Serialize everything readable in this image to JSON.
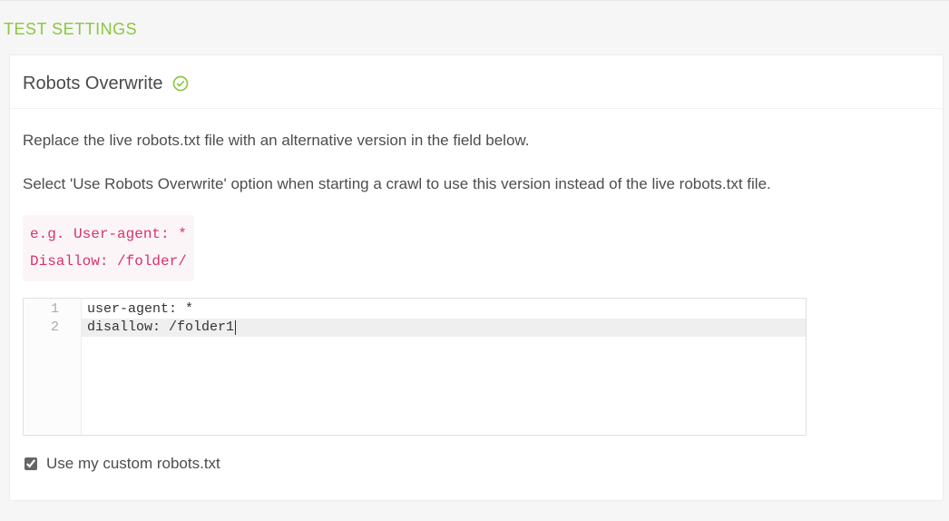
{
  "sectionTitle": "TEST SETTINGS",
  "panel": {
    "title": "Robots Overwrite",
    "statusIcon": "check-circle",
    "description1": "Replace the live robots.txt file with an alternative version in the field below.",
    "description2": "Select 'Use Robots Overwrite' option when starting a crawl to use this version instead of the live robots.txt file.",
    "example": "e.g. User-agent: *\nDisallow: /folder/",
    "editor": {
      "lines": [
        {
          "num": "1",
          "text": "user-agent: *"
        },
        {
          "num": "2",
          "text": "disallow: /folder1"
        }
      ],
      "activeLine": 2
    },
    "checkbox": {
      "label": "Use my custom robots.txt",
      "checked": true
    }
  }
}
